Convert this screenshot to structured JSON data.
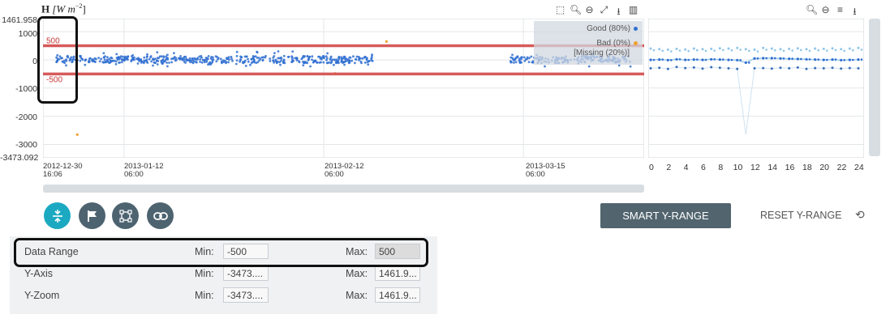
{
  "chart": {
    "ylabel_bold": "H",
    "ylabel_units": "[W m",
    "ylabel_exp": "−2",
    "ylabel_close": "]",
    "yticks": [
      "1461.958",
      "1000",
      "0",
      "-1000",
      "-2000",
      "-3000",
      "-3473.092"
    ],
    "xticks": [
      {
        "date": "2012-12-30",
        "time": "16:06"
      },
      {
        "date": "2013-01-12",
        "time": "06:00"
      },
      {
        "date": "2013-02-12",
        "time": "06:00"
      },
      {
        "date": "2013-03-15",
        "time": "06:00"
      }
    ],
    "thresholds": [
      {
        "label": "500",
        "value": 500
      },
      {
        "label": "-500",
        "value": -500
      }
    ],
    "legend": [
      {
        "label": "Good (80%)",
        "color": "#2f6fd1"
      },
      {
        "label": "Bad (0%)",
        "color": "#f0a030"
      },
      {
        "label": "[Missing (20%)]",
        "color": ""
      }
    ],
    "hour_ticks": [
      "0",
      "2",
      "4",
      "6",
      "8",
      "10",
      "12",
      "14",
      "16",
      "18",
      "20",
      "22",
      "24"
    ]
  },
  "chart_data": {
    "type": "scatter",
    "ylim": [
      -3473.092,
      1461.958
    ],
    "xrange": [
      "2012-12-30 16:06",
      "2013-04-03"
    ],
    "good_band": [
      -250,
      300
    ],
    "threshold_max": 500,
    "threshold_min": -500,
    "outliers_bad": [
      {
        "x": "2013-01-05",
        "y": -2650
      },
      {
        "x": "2013-02-22",
        "y": 650
      },
      {
        "x": "2013-02-14",
        "y": -480
      }
    ],
    "diurnal": {
      "hours": [
        0,
        1,
        2,
        3,
        4,
        5,
        6,
        7,
        8,
        9,
        10,
        11,
        12,
        13,
        14,
        15,
        16,
        17,
        18,
        19,
        20,
        21,
        22,
        23,
        24
      ],
      "upper": [
        400,
        380,
        360,
        390,
        370,
        400,
        380,
        390,
        410,
        400,
        420,
        380,
        360,
        420,
        400,
        380,
        390,
        410,
        380,
        400,
        390,
        410,
        380,
        400,
        420
      ],
      "mean": [
        0,
        10,
        -10,
        20,
        0,
        10,
        0,
        20,
        10,
        0,
        -10,
        -100,
        50,
        60,
        60,
        50,
        40,
        30,
        20,
        10,
        0,
        10,
        -10,
        0,
        10
      ],
      "lower": [
        -300,
        -280,
        -320,
        -250,
        -290,
        -270,
        -310,
        -260,
        -280,
        -300,
        -320,
        -2650,
        -300,
        -290,
        -310,
        -280,
        -300,
        -270,
        -320,
        -290,
        -300,
        -280,
        -310,
        -290,
        -300
      ]
    }
  },
  "toolbar_main": [
    "box-zoom-icon",
    "zoom-icon",
    "zoom-out-icon",
    "fullscreen-icon",
    "download-icon",
    "book-icon"
  ],
  "toolbar_side": [
    "zoom-icon",
    "zoom-out-icon",
    "menu-icon",
    "download-icon"
  ],
  "controls": {
    "smart_label": "SMART Y-RANGE",
    "reset_label": "RESET Y-RANGE"
  },
  "ranges": [
    {
      "label": "Data Range",
      "min_label": "Min:",
      "min": "-500",
      "max_label": "Max:",
      "max": "500"
    },
    {
      "label": "Y-Axis",
      "min_label": "Min:",
      "min": "-3473....",
      "max_label": "Max:",
      "max": "1461.9..."
    },
    {
      "label": "Y-Zoom",
      "min_label": "Min:",
      "min": "-3473....",
      "max_label": "Max:",
      "max": "1461.9..."
    }
  ],
  "colors": {
    "good": "#2f6fd1",
    "bad": "#f0a030",
    "threshold": "#d65a5a",
    "accent": "#1ba9c2"
  }
}
